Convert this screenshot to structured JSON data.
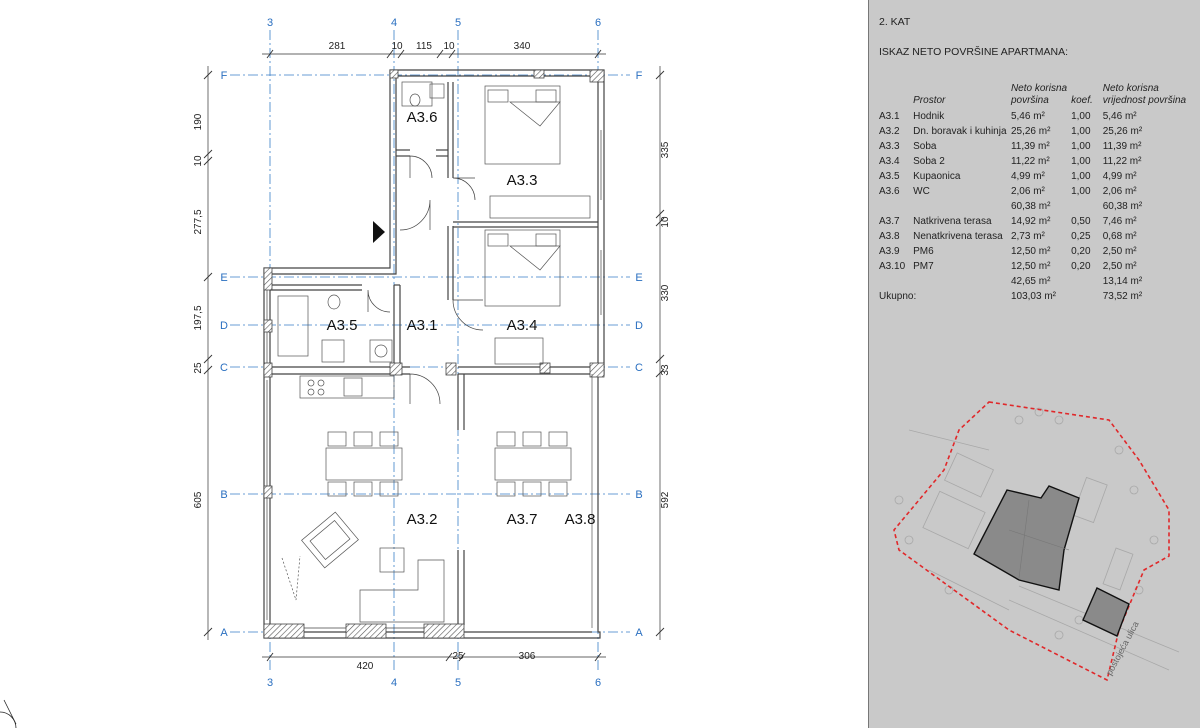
{
  "floor_title": "2. KAT",
  "table_title": "ISKAZ NETO POVRŠINE APARTMANA:",
  "table": {
    "headers": {
      "room": "Prostor",
      "net_area_1": "Neto korisna",
      "net_area_2": "površina",
      "coef": "koef.",
      "value_1": "Neto korisna",
      "value_2": "vrijednost površina"
    },
    "rows_a": [
      {
        "code": "A3.1",
        "name": "Hodnik",
        "area": "5,46 m²",
        "coef": "1,00",
        "value": "5,46 m²"
      },
      {
        "code": "A3.2",
        "name": "Dn. boravak i kuhinja",
        "area": "25,26 m²",
        "coef": "1,00",
        "value": "25,26 m²"
      },
      {
        "code": "A3.3",
        "name": "Soba",
        "area": "11,39 m²",
        "coef": "1,00",
        "value": "11,39 m²"
      },
      {
        "code": "A3.4",
        "name": "Soba 2",
        "area": "11,22 m²",
        "coef": "1,00",
        "value": "11,22 m²"
      },
      {
        "code": "A3.5",
        "name": "Kupaonica",
        "area": "4,99 m²",
        "coef": "1,00",
        "value": "4,99 m²"
      },
      {
        "code": "A3.6",
        "name": "WC",
        "area": "2,06 m²",
        "coef": "1,00",
        "value": "2,06 m²"
      }
    ],
    "subtotal_a": {
      "area": "60,38 m²",
      "value": "60,38 m²"
    },
    "rows_b": [
      {
        "code": "A3.7",
        "name": "Natkrivena terasa",
        "area": "14,92 m²",
        "coef": "0,50",
        "value": "7,46 m²"
      },
      {
        "code": "A3.8",
        "name": "Nenatkrivena terasa",
        "area": "2,73 m²",
        "coef": "0,25",
        "value": "0,68 m²"
      },
      {
        "code": "A3.9",
        "name": "PM6",
        "area": "12,50 m²",
        "coef": "0,20",
        "value": "2,50 m²"
      },
      {
        "code": "A3.10",
        "name": "PM7",
        "area": "12,50 m²",
        "coef": "0,20",
        "value": "2,50 m²"
      }
    ],
    "subtotal_b": {
      "area": "42,65 m²",
      "value": "13,14 m²"
    },
    "total": {
      "label": "Ukupno:",
      "area": "103,03 m²",
      "value": "73,52 m²"
    }
  },
  "plan": {
    "room_labels": {
      "a36": "A3.6",
      "a33": "A3.3",
      "a35": "A3.5",
      "a31": "A3.1",
      "a34": "A3.4",
      "a32": "A3.2",
      "a37": "A3.7",
      "a38": "A3.8"
    },
    "grid_columns": {
      "c1": "3",
      "c2": "4",
      "c3": "5",
      "c4": "6"
    },
    "grid_rows": {
      "f": "F",
      "e": "E",
      "d": "D",
      "c": "C",
      "b": "B",
      "a": "A"
    },
    "top_dims": {
      "d1": "281",
      "d2": "10",
      "d3": "115",
      "d4": "10",
      "d5": "340"
    },
    "bottom_dims": {
      "d1": "420",
      "d2": "25",
      "d3": "306"
    },
    "left_dims": {
      "d1": "190",
      "d2": "10",
      "d3": "277,5",
      "d4": "197,5",
      "d5": "25",
      "d6": "605"
    },
    "right_dims": {
      "d1": "335",
      "d2": "10",
      "d3": "330",
      "d4": "33",
      "d5": "592"
    },
    "site_street_label": "postojeća ulica"
  },
  "colors": {
    "grid_line": "#3a7fc8",
    "grid_text": "#2a6fc0",
    "wall": "#444444",
    "panel_bg": "#c9c9c9",
    "site_border": "#e0282a"
  }
}
